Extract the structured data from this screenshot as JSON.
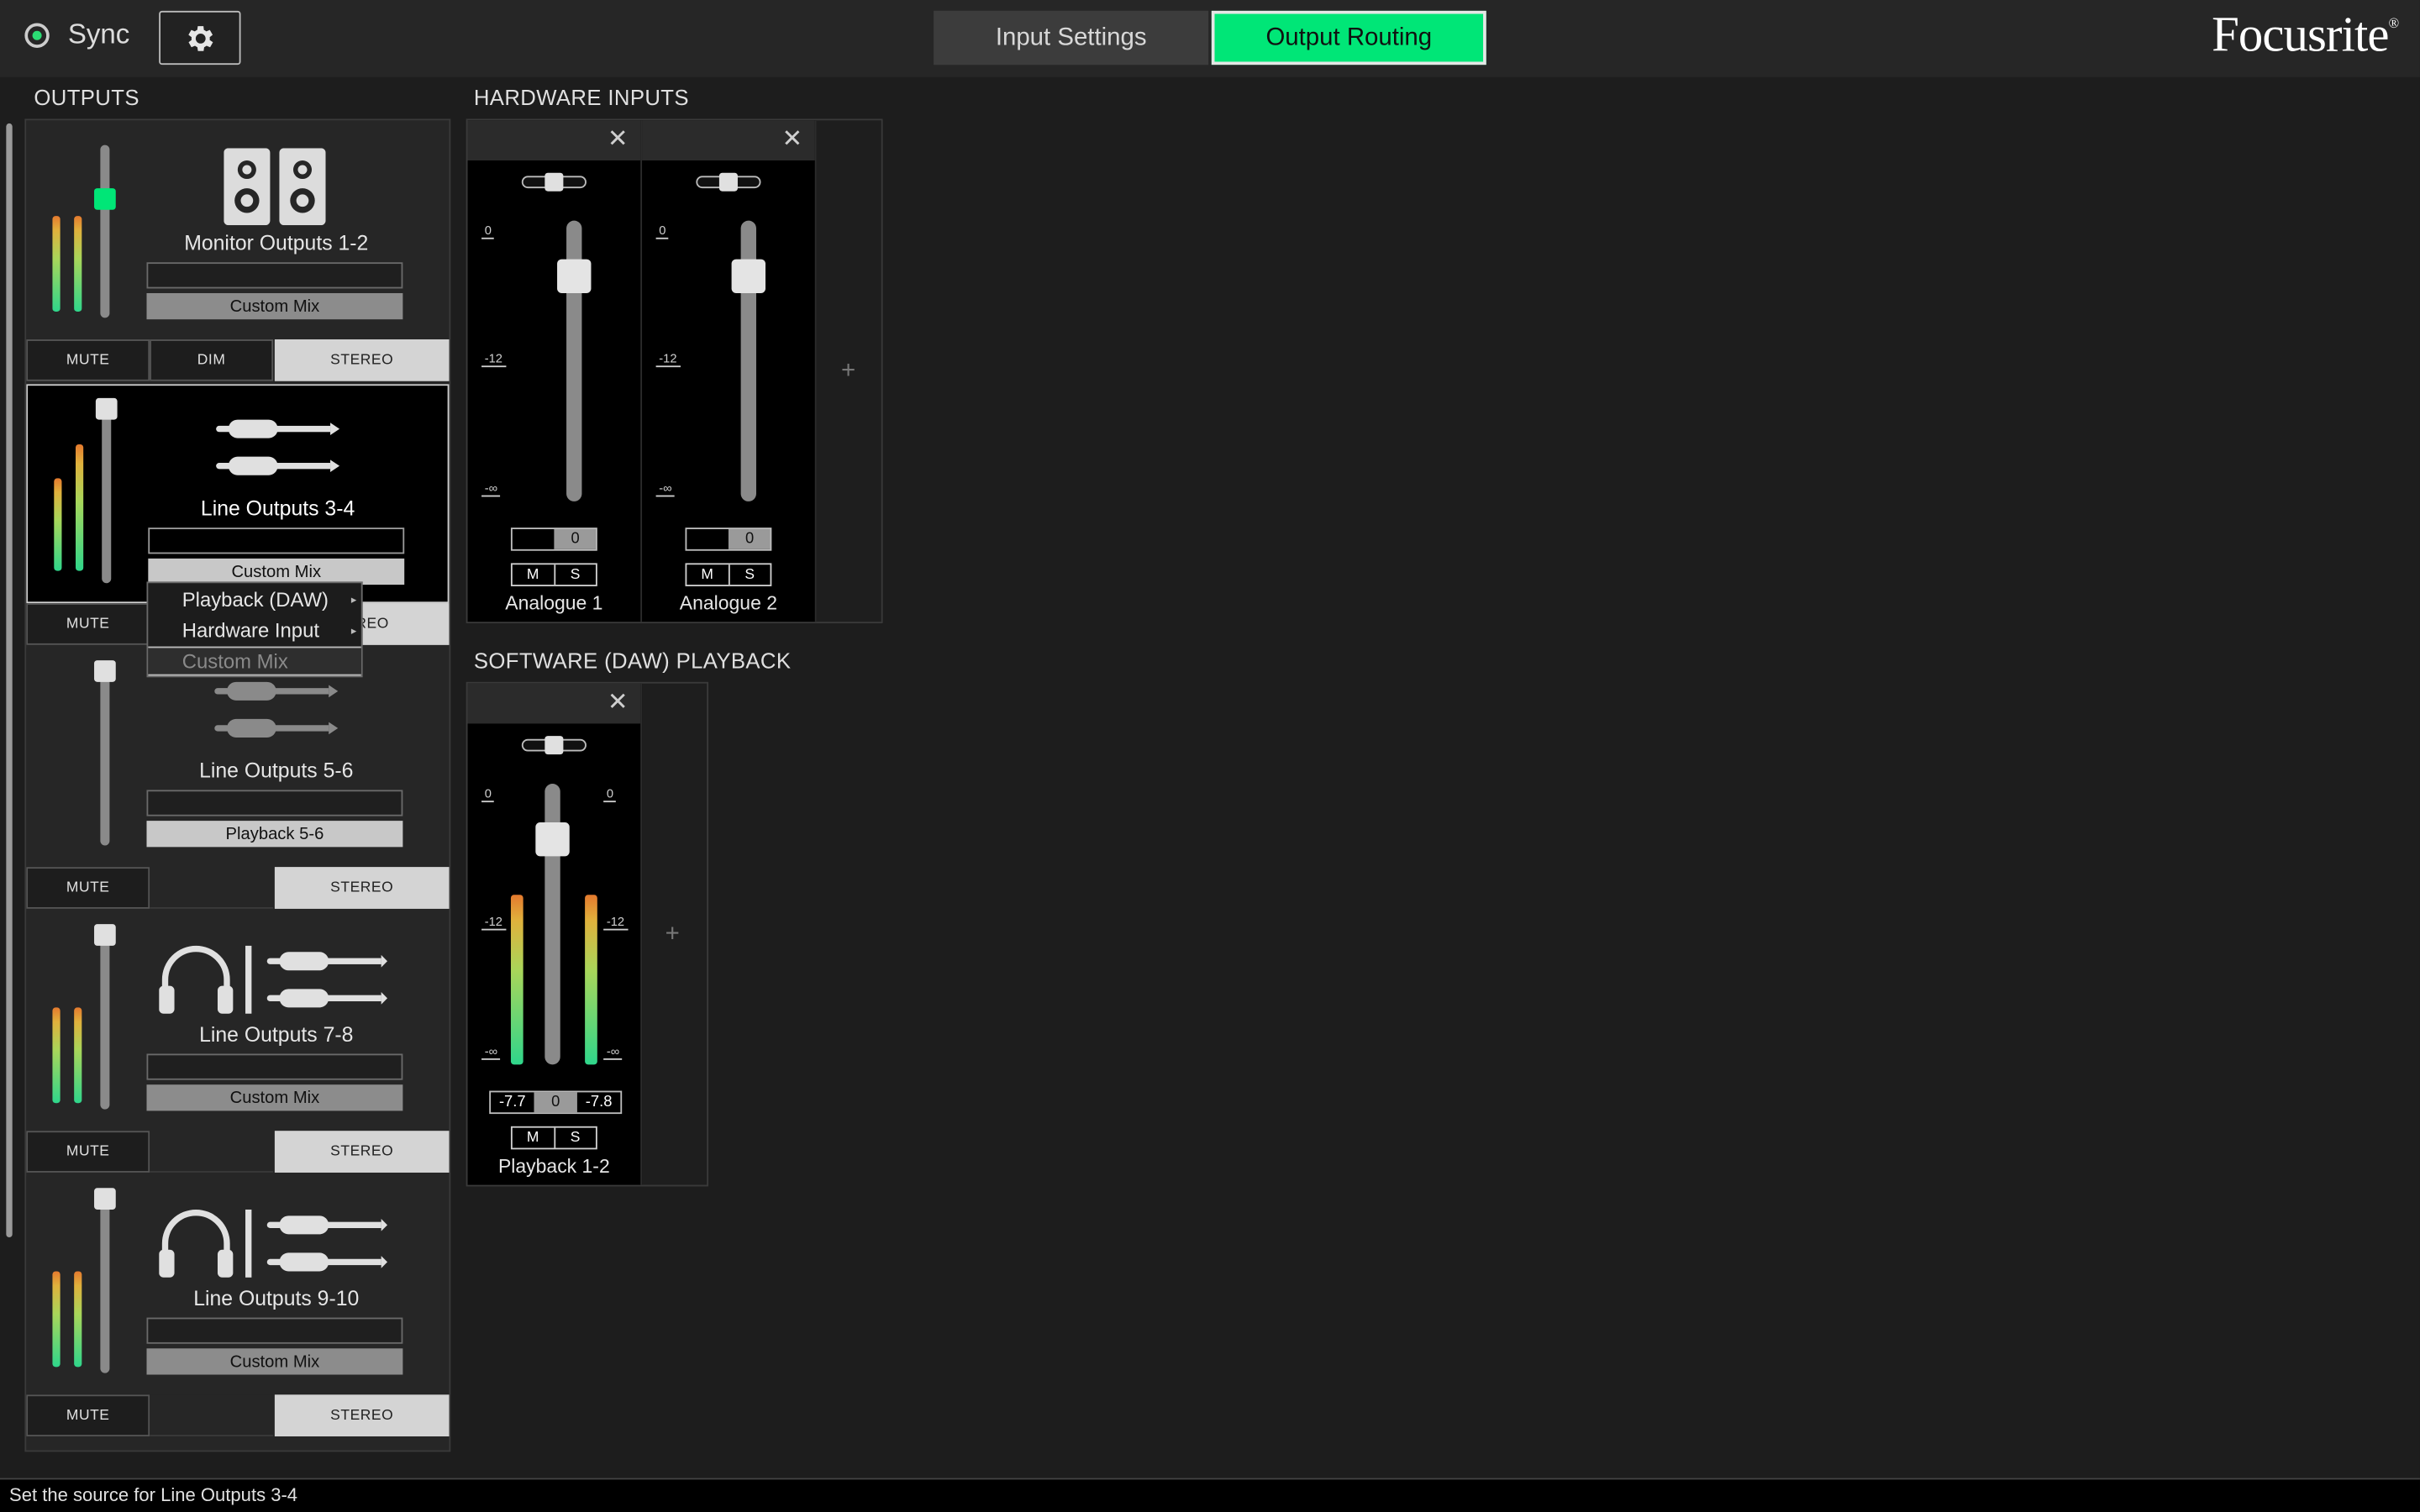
{
  "topbar": {
    "sync_label": "Sync",
    "tabs": [
      {
        "label": "Input Settings",
        "active": false
      },
      {
        "label": "Output Routing",
        "active": true
      }
    ],
    "logo": "Focusrite",
    "logo_mark": "®"
  },
  "outputs": {
    "title": "OUTPUTS",
    "cards": [
      {
        "name": "Monitor Outputs 1-2",
        "source": "Custom Mix",
        "buttons": {
          "mute": "MUTE",
          "dim": "DIM",
          "stereo": "STEREO"
        },
        "icon": "speakers-icon",
        "fader_level": 0.67
      },
      {
        "name": "Line Outputs 3-4",
        "source": "Custom Mix",
        "buttons": {
          "mute": "MUTE",
          "stereo": "STEREO",
          "stereo_visible": "REO"
        },
        "icon": "jack-cables-icon",
        "selected": true,
        "fader_level": 0.98
      },
      {
        "name": "Line Outputs 5-6",
        "source": "Playback 5-6",
        "buttons": {
          "mute": "MUTE",
          "stereo": "STEREO"
        },
        "icon": "jack-cables-icon",
        "fader_level": 0.98
      },
      {
        "name": "Line Outputs 7-8",
        "source": "Custom Mix",
        "buttons": {
          "mute": "MUTE",
          "stereo": "STEREO"
        },
        "icon": "headphones-jack-icon",
        "fader_level": 0.98
      },
      {
        "name": "Line Outputs 9-10",
        "source": "Custom Mix",
        "buttons": {
          "mute": "MUTE",
          "stereo": "STEREO"
        },
        "icon": "headphones-jack-icon",
        "fader_level": 0.98
      }
    ]
  },
  "source_menu": {
    "items": [
      {
        "label": "Playback (DAW)",
        "has_submenu": true
      },
      {
        "label": "Hardware Input",
        "has_submenu": true
      },
      {
        "label": "Custom Mix",
        "disabled": true
      }
    ]
  },
  "hardware_inputs": {
    "title": "HARDWARE INPUTS",
    "scale": {
      "top": "0",
      "mid": "-12",
      "bottom": "-∞"
    },
    "strips": [
      {
        "name": "Analogue 1",
        "value": "0",
        "mute": "M",
        "solo": "S"
      },
      {
        "name": "Analogue 2",
        "value": "0",
        "mute": "M",
        "solo": "S"
      }
    ],
    "add": "+"
  },
  "daw_playback": {
    "title": "SOFTWARE (DAW) PLAYBACK",
    "scale": {
      "top": "0",
      "mid": "-12",
      "bottom": "-∞"
    },
    "strips": [
      {
        "name": "Playback 1-2",
        "left_level": "-7.7",
        "value": "0",
        "right_level": "-7.8",
        "mute": "M",
        "solo": "S"
      }
    ],
    "add": "+"
  },
  "status": {
    "text": "Set the source for Line Outputs 3-4"
  }
}
